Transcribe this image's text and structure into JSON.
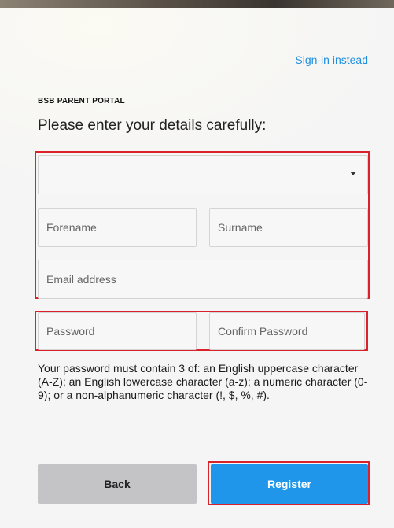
{
  "header": {
    "signin_link": "Sign-in instead"
  },
  "form": {
    "portal_label": "BSB PARENT PORTAL",
    "heading": "Please enter your details carefully:",
    "select": {
      "value": ""
    },
    "forename": {
      "value": "",
      "placeholder": "Forename"
    },
    "surname": {
      "value": "",
      "placeholder": "Surname"
    },
    "email": {
      "value": "",
      "placeholder": "Email address"
    },
    "password": {
      "value": "",
      "placeholder": "Password"
    },
    "confirm_password": {
      "value": "",
      "placeholder": "Confirm Password"
    },
    "password_hint": "Your password must contain 3 of: an English uppercase character (A-Z); an English lowercase character (a-z); a numeric character (0-9); or a non-alphanumeric character (!, $, %, #)."
  },
  "actions": {
    "back_label": "Back",
    "register_label": "Register"
  },
  "colors": {
    "accent": "#1f96ea",
    "link": "#1f8fe0",
    "highlight_border": "#d9222a",
    "back_button": "#c4c4c7"
  }
}
